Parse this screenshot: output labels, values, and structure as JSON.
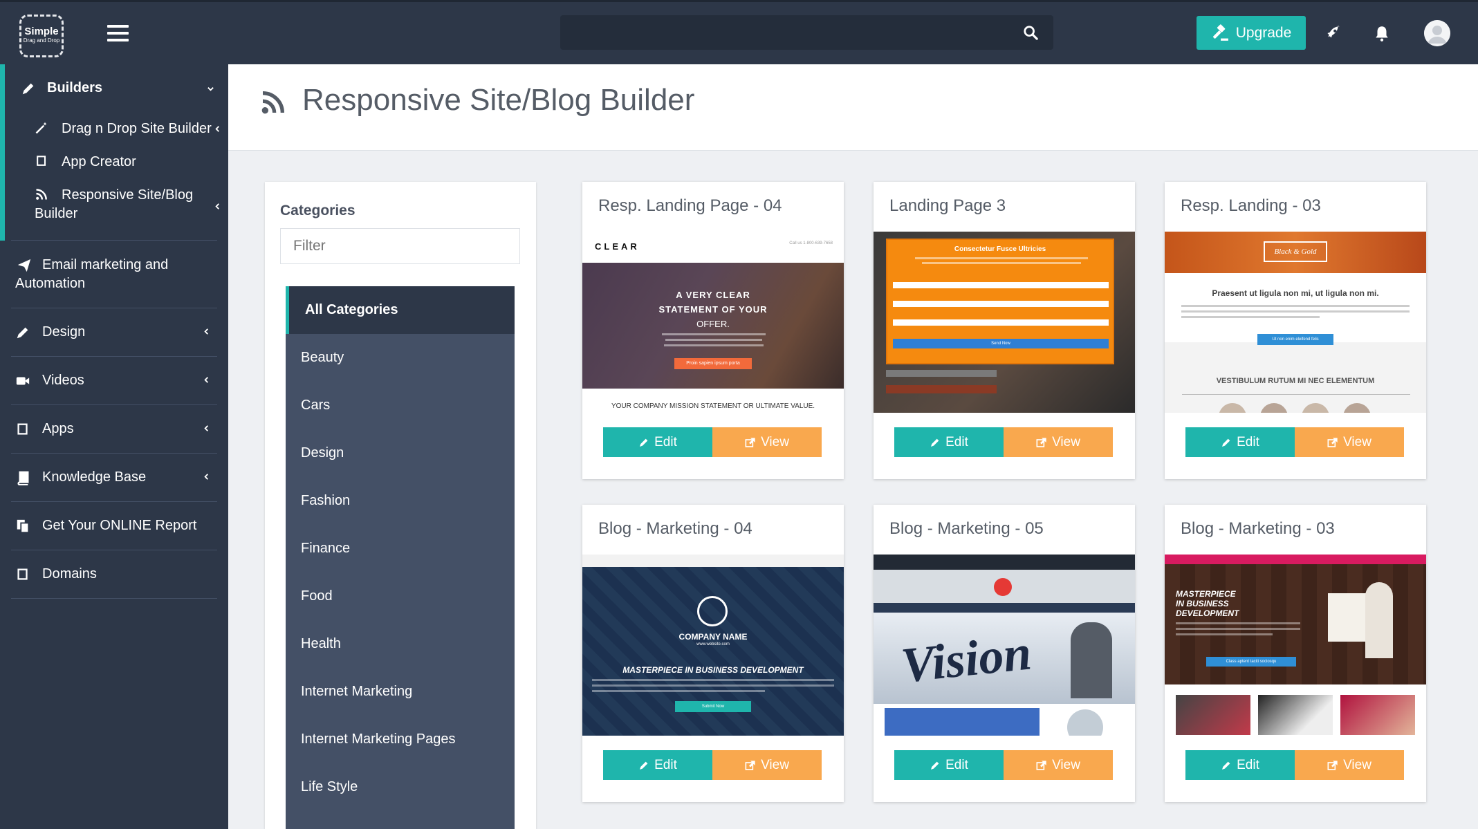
{
  "app": {
    "logo_line1": "Simple",
    "logo_line2": "Drag and Drop"
  },
  "topbar": {
    "search_placeholder": "",
    "upgrade_label": "Upgrade"
  },
  "sidebar": {
    "builders_label": "Builders",
    "sub_items": [
      {
        "label": "Drag n Drop Site Builder"
      },
      {
        "label": "App Creator"
      },
      {
        "label_line1": "Responsive Site/Blog",
        "label_line2": "Builder"
      }
    ],
    "items": [
      {
        "label_line1": "Email marketing and",
        "label_line2": "Automation"
      },
      {
        "label": "Design"
      },
      {
        "label": "Videos"
      },
      {
        "label": "Apps"
      },
      {
        "label": "Knowledge Base"
      },
      {
        "label": "Get Your ONLINE Report"
      },
      {
        "label": "Domains"
      }
    ]
  },
  "page": {
    "title": "Responsive Site/Blog Builder"
  },
  "categories": {
    "title": "Categories",
    "filter_placeholder": "Filter",
    "items": [
      "All Categories",
      "Beauty",
      "Cars",
      "Design",
      "Fashion",
      "Finance",
      "Food",
      "Health",
      "Internet Marketing",
      "Internet Marketing Pages",
      "Life Style"
    ]
  },
  "cards": [
    {
      "title": "Resp. Landing Page - 04",
      "edit_label": "Edit",
      "view_label": "View",
      "thumb": {
        "brand": "CLEAR",
        "phone": "Call us 1-800-639-7658",
        "headline1": "A VERY CLEAR",
        "headline2": "STATEMENT OF YOUR",
        "headline3": "OFFER.",
        "cta": "Proin sapien ipsum porta",
        "footer": "YOUR COMPANY MISSION STATEMENT OR ULTIMATE VALUE."
      }
    },
    {
      "title": "Landing Page 3",
      "edit_label": "Edit",
      "view_label": "View",
      "thumb": {
        "form_title": "Consectetur Fusce Ultricies",
        "send": "Send Now"
      }
    },
    {
      "title": "Resp. Landing - 03",
      "edit_label": "Edit",
      "view_label": "View",
      "thumb": {
        "logo": "Black & Gold",
        "headline": "Praesent ut ligula non mi, ut ligula non mi.",
        "cta": "Ut non enim eleifend felis",
        "section": "VESTIBULUM RUTUM MI NEC ELEMENTUM"
      }
    },
    {
      "title": "Blog - Marketing - 04",
      "edit_label": "Edit",
      "view_label": "View",
      "thumb": {
        "company": "COMPANY NAME",
        "website": "www.website.com",
        "tagline": "MASTERPIECE IN BUSINESS DEVELOPMENT",
        "cta": "Submit Now"
      }
    },
    {
      "title": "Blog - Marketing - 05",
      "edit_label": "Edit",
      "view_label": "View",
      "thumb": {
        "word": "Vision"
      }
    },
    {
      "title": "Blog - Marketing - 03",
      "edit_label": "Edit",
      "view_label": "View",
      "thumb": {
        "line1": "MASTERPIECE",
        "line2": "IN BUSINESS",
        "line3": "DEVELOPMENT",
        "cta": "Class aptent taciti sociosqu"
      }
    }
  ],
  "colors": {
    "sidebar_bg": "#2d3748",
    "accent_teal": "#1fb5ac",
    "view_orange": "#f9a84e",
    "category_list_bg": "#445066"
  }
}
